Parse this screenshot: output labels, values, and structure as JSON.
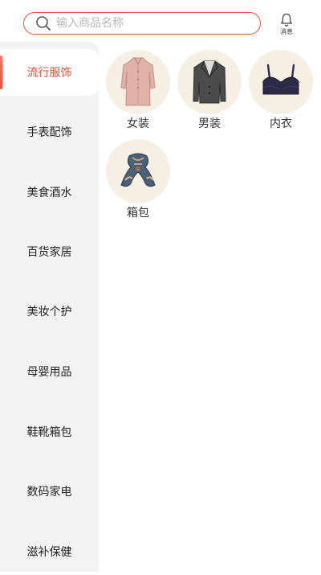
{
  "search": {
    "placeholder": "输入商品名称"
  },
  "message": {
    "label": "消息",
    "icon": "bell-icon"
  },
  "sidebar": {
    "items": [
      {
        "label": "流行服饰",
        "active": true
      },
      {
        "label": "手表配饰"
      },
      {
        "label": "美食酒水"
      },
      {
        "label": "百货家居"
      },
      {
        "label": "美妆个护"
      },
      {
        "label": "母婴用品"
      },
      {
        "label": "鞋靴箱包"
      },
      {
        "label": "数码家电"
      },
      {
        "label": "滋补保健"
      }
    ]
  },
  "categories": [
    {
      "label": "女装",
      "icon": "dress-icon"
    },
    {
      "label": "男装",
      "icon": "suit-jacket-icon"
    },
    {
      "label": "内衣",
      "icon": "bra-icon"
    },
    {
      "label": "箱包",
      "icon": "scarf-icon"
    }
  ],
  "colors": {
    "accent": "#e8503a",
    "sidebar_bg": "#f3f3f3",
    "circle_bg": "#f5efe4"
  }
}
